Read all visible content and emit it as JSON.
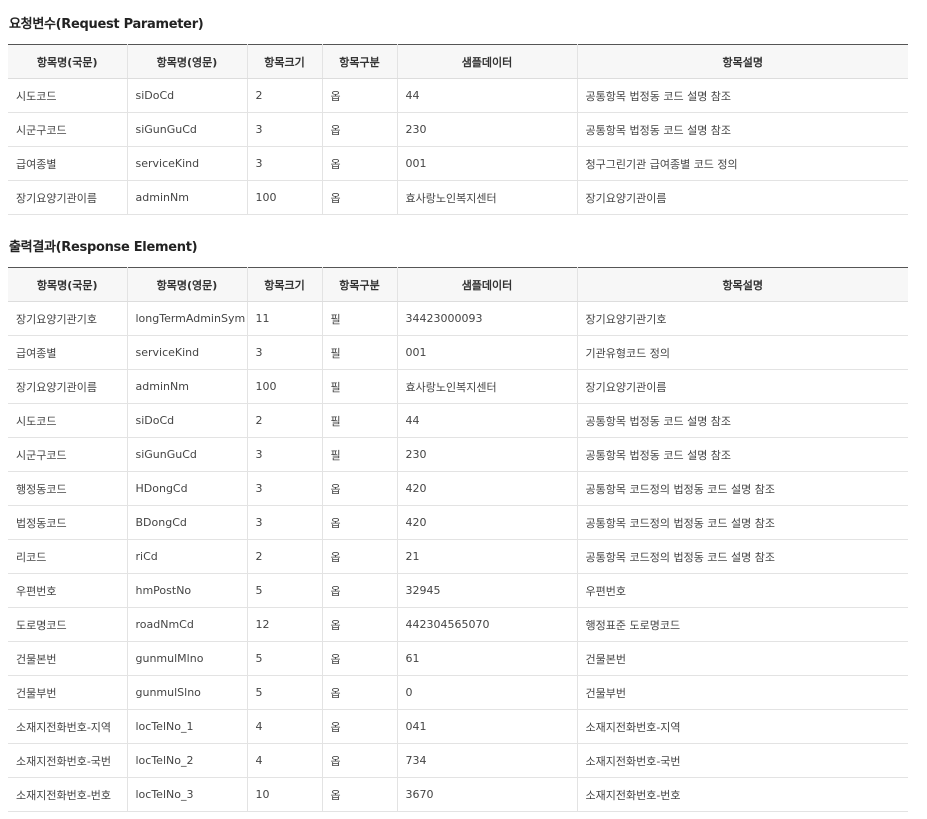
{
  "request": {
    "title": "요청변수(Request Parameter)",
    "headers": [
      "항목명(국문)",
      "항목명(영문)",
      "항목크기",
      "항목구분",
      "샘플데이터",
      "항목설명"
    ],
    "rows": [
      [
        "시도코드",
        "siDoCd",
        "2",
        "옵",
        "44",
        "공통항목 법정동 코드 설명 참조"
      ],
      [
        "시군구코드",
        "siGunGuCd",
        "3",
        "옵",
        "230",
        "공통항목 법정동 코드 설명 참조"
      ],
      [
        "급여종별",
        "serviceKind",
        "3",
        "옵",
        "001",
        "청구그린기관 급여종별 코드 정의"
      ],
      [
        "장기요양기관이름",
        "adminNm",
        "100",
        "옵",
        "효사랑노인복지센터",
        "장기요양기관이름"
      ]
    ]
  },
  "response": {
    "title": "출력결과(Response Element)",
    "headers": [
      "항목명(국문)",
      "항목명(영문)",
      "항목크기",
      "항목구분",
      "샘플데이터",
      "항목설명"
    ],
    "rows": [
      [
        "장기요양기관기호",
        "longTermAdminSym",
        "11",
        "필",
        "34423000093",
        "장기요양기관기호"
      ],
      [
        "급여종별",
        "serviceKind",
        "3",
        "필",
        "001",
        "기관유형코드 정의"
      ],
      [
        "장기요양기관이름",
        "adminNm",
        "100",
        "필",
        "효사랑노인복지센터",
        "장기요양기관이름"
      ],
      [
        "시도코드",
        "siDoCd",
        "2",
        "필",
        "44",
        "공통항목 법정동 코드 설명 참조"
      ],
      [
        "시군구코드",
        "siGunGuCd",
        "3",
        "필",
        "230",
        "공통항목 법정동 코드 설명 참조"
      ],
      [
        "행정동코드",
        "HDongCd",
        "3",
        "옵",
        "420",
        "공통항목 코드정의 법정동 코드 설명 참조"
      ],
      [
        "법정동코드",
        "BDongCd",
        "3",
        "옵",
        "420",
        "공통항목 코드정의 법정동 코드 설명 참조"
      ],
      [
        "리코드",
        "riCd",
        "2",
        "옵",
        "21",
        "공통항목 코드정의 법정동 코드 설명 참조"
      ],
      [
        "우편번호",
        "hmPostNo",
        "5",
        "옵",
        "32945",
        "우편번호"
      ],
      [
        "도로명코드",
        "roadNmCd",
        "12",
        "옵",
        "442304565070",
        "행정표준 도로명코드"
      ],
      [
        "건물본번",
        "gunmulMlno",
        "5",
        "옵",
        "61",
        "건물본번"
      ],
      [
        "건물부번",
        "gunmulSlno",
        "5",
        "옵",
        "0",
        "건물부번"
      ],
      [
        "소재지전화번호-지역",
        "locTelNo_1",
        "4",
        "옵",
        "041",
        "소재지전화번호-지역"
      ],
      [
        "소재지전화번호-국번",
        "locTelNo_2",
        "4",
        "옵",
        "734",
        "소재지전화번호-국번"
      ],
      [
        "소재지전화번호-번호",
        "locTelNo_3",
        "10",
        "옵",
        "3670",
        "소재지전화번호-번호"
      ]
    ]
  }
}
